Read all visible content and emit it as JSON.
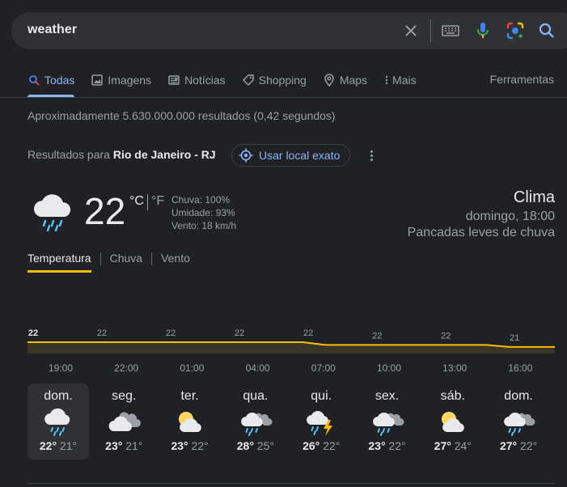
{
  "search": {
    "query": "weather",
    "icons": [
      "close-icon",
      "keyboard-icon",
      "mic-icon",
      "lens-icon",
      "search-icon"
    ]
  },
  "tabs": [
    {
      "label": "Todas",
      "icon": "search-icon",
      "active": true
    },
    {
      "label": "Imagens",
      "icon": "image-icon",
      "active": false
    },
    {
      "label": "Notícias",
      "icon": "news-icon",
      "active": false
    },
    {
      "label": "Shopping",
      "icon": "tag-icon",
      "active": false
    },
    {
      "label": "Maps",
      "icon": "pin-icon",
      "active": false
    },
    {
      "label": "Mais",
      "icon": "more-vert-icon",
      "active": false
    }
  ],
  "tools_label": "Ferramentas",
  "stats": "Aproximadamente 5.630.000.000 resultados (0,42 segundos)",
  "location": {
    "prefix": "Resultados para",
    "place": "Rio de Janeiro - RJ",
    "exact_button": "Usar local exato"
  },
  "current": {
    "icon": "cloud-rain-icon",
    "temp": "22",
    "unit_c": "°C",
    "unit_f": "°F",
    "precip": "Chuva: 100%",
    "humidity": "Umidade: 93%",
    "wind": "Vento: 18 km/h",
    "title": "Clima",
    "time": "domingo, 18:00",
    "desc": "Pancadas leves de chuva"
  },
  "weather_tabs": [
    "Temperatura",
    "Chuva",
    "Vento"
  ],
  "chart_data": {
    "type": "area",
    "x": [
      "19:00",
      "20:00",
      "21:00",
      "22:00",
      "23:00",
      "00:00",
      "01:00",
      "02:00",
      "03:00",
      "04:00",
      "05:00",
      "06:00",
      "07:00",
      "08:00",
      "09:00",
      "10:00",
      "11:00",
      "12:00",
      "13:00",
      "14:00",
      "15:00",
      "16:00",
      "17:00",
      "18:00"
    ],
    "values": [
      22,
      22,
      22,
      22,
      22,
      22,
      22,
      22,
      22,
      22,
      22,
      22,
      22,
      21.6,
      21.6,
      21.6,
      21.6,
      21.6,
      21.6,
      21.6,
      21.6,
      21.3,
      21.3,
      21.3
    ],
    "labels": [
      {
        "text": "22",
        "bold": true
      },
      {
        "text": "22"
      },
      {
        "text": "22"
      },
      {
        "text": "22"
      },
      {
        "text": "22"
      },
      {
        "text": "22"
      },
      {
        "text": "22"
      },
      {
        "text": "21"
      }
    ],
    "tick_labels": [
      "19:00",
      "22:00",
      "01:00",
      "04:00",
      "07:00",
      "10:00",
      "13:00",
      "16:00"
    ],
    "line_color": "#fbbc04",
    "fill_color": "#3a3626"
  },
  "days": [
    {
      "name": "dom.",
      "icon": "cloud-rain-icon",
      "hi": "22°",
      "lo": "21°",
      "active": true
    },
    {
      "name": "seg.",
      "icon": "cloudy-icon",
      "hi": "23°",
      "lo": "21°"
    },
    {
      "name": "ter.",
      "icon": "partly-cloudy-icon",
      "hi": "23°",
      "lo": "22°"
    },
    {
      "name": "qua.",
      "icon": "cloud-showers-icon",
      "hi": "28°",
      "lo": "25°"
    },
    {
      "name": "qui.",
      "icon": "thunderstorm-icon",
      "hi": "26°",
      "lo": "22°"
    },
    {
      "name": "sex.",
      "icon": "cloud-showers-icon",
      "hi": "23°",
      "lo": "22°"
    },
    {
      "name": "sáb.",
      "icon": "partly-cloudy-icon",
      "hi": "27°",
      "lo": "24°"
    },
    {
      "name": "dom.",
      "icon": "cloud-showers-icon",
      "hi": "27°",
      "lo": "22°"
    }
  ]
}
